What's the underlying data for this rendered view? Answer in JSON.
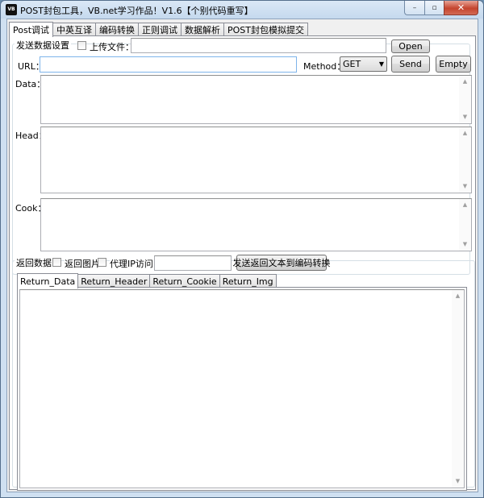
{
  "window": {
    "title": "POST封包工具，VB.net学习作品！V1.6【个别代码重写】",
    "icon_label": "VB",
    "controls": {
      "minimize": "–",
      "maximize": "▫",
      "close": "✕"
    }
  },
  "main_tabs": [
    "Post调试",
    "中英互译",
    "编码转换",
    "正则调试",
    "数据解析",
    "POST封包模拟提交"
  ],
  "send": {
    "group_label": "发送数据设置",
    "upload_label": "上传文件：",
    "upload_path": "",
    "open_label": "Open",
    "url_label": "URL：",
    "url_value": "",
    "method_label": "Method：",
    "method_value": "GET",
    "send_label": "Send",
    "empty_label": "Empty",
    "data_label": "Data：",
    "head_label": "Head：",
    "cook_label": "Cook："
  },
  "response": {
    "group_label": "返回数据",
    "return_image_label": "返回图片",
    "proxy_label": "代理IP访问：",
    "proxy_value": "",
    "transfer_label": "发送返回文本到编码转换",
    "tabs": [
      "Return_Data",
      "Return_Header",
      "Return_Cookie",
      "Return_Img"
    ]
  }
}
